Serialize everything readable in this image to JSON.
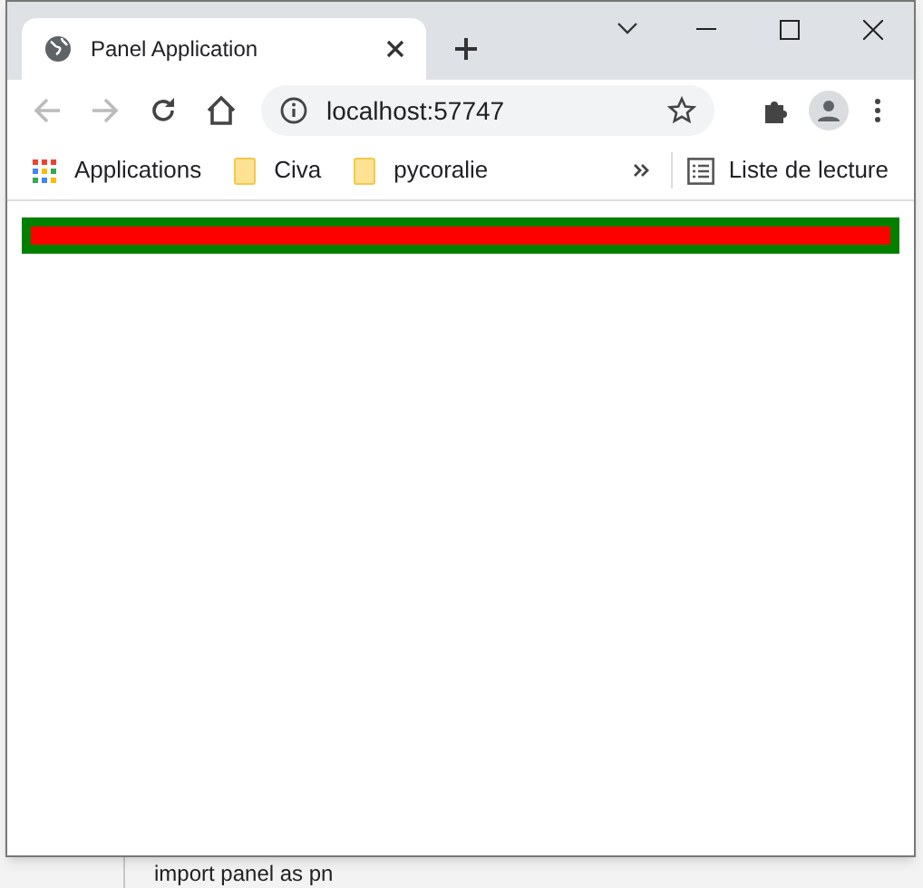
{
  "background": {
    "code_line": "import panel as pn"
  },
  "tabs": [
    {
      "title": "Panel Application",
      "selected": true
    }
  ],
  "address_bar": {
    "url": "localhost:57747"
  },
  "bookmarks": [
    {
      "label": "Applications",
      "kind": "apps"
    },
    {
      "label": "Civa",
      "kind": "folder"
    },
    {
      "label": "pycoralie",
      "kind": "folder"
    }
  ],
  "reading_list": {
    "label": "Liste de lecture"
  }
}
